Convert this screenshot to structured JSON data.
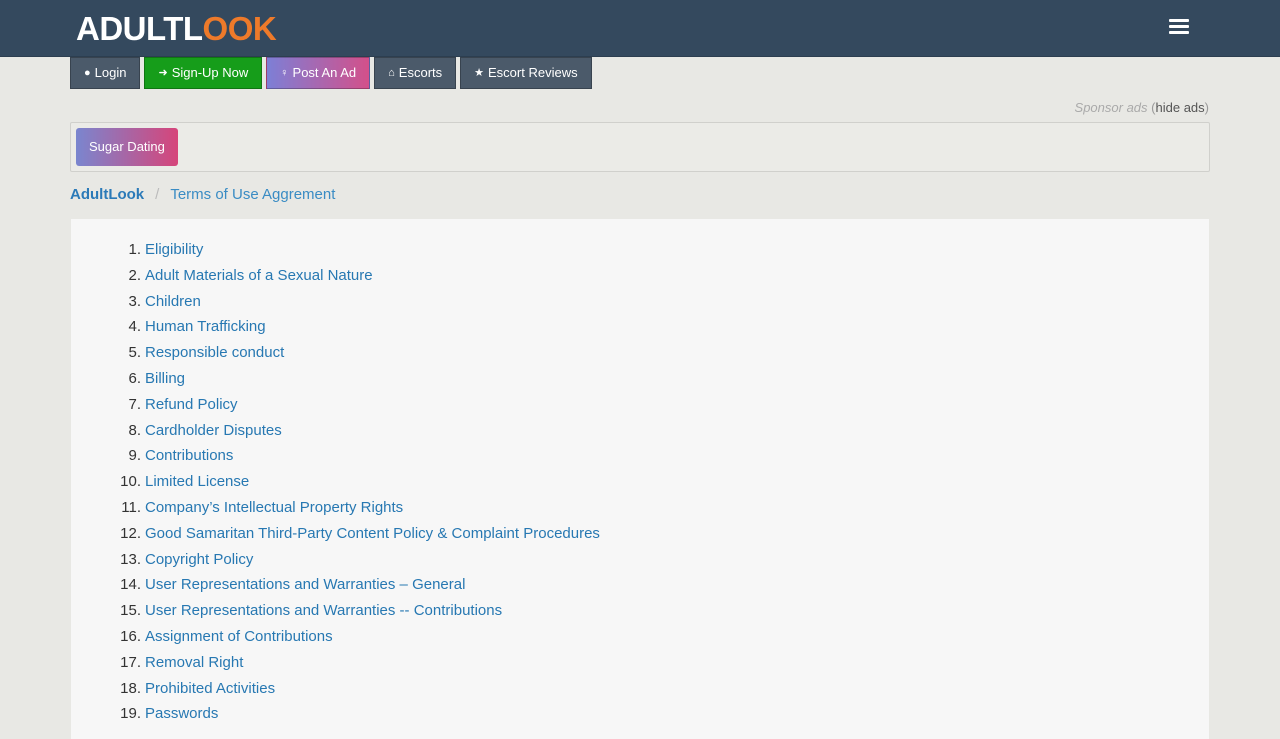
{
  "header": {
    "logo_part1": "ADULTL",
    "logo_part2": "OO",
    "logo_part3": "K"
  },
  "nav": {
    "login": "Login",
    "signup": "Sign-Up Now",
    "post_ad": "Post An Ad",
    "escorts": "Escorts",
    "reviews": "Escort Reviews"
  },
  "sponsor": {
    "label": "Sponsor ads",
    "open": "(",
    "hide": "hide ads",
    "close": ")"
  },
  "ad": {
    "sugar_dating": "Sugar Dating"
  },
  "breadcrumb": {
    "home": "AdultLook",
    "separator": "/",
    "current": "Terms of Use Aggrement"
  },
  "toc": [
    {
      "num": "1.",
      "label": "Eligibility"
    },
    {
      "num": "2.",
      "label": "Adult Materials of a Sexual Nature"
    },
    {
      "num": "3.",
      "label": "Children"
    },
    {
      "num": "4.",
      "label": "Human Trafficking"
    },
    {
      "num": "5.",
      "label": "Responsible conduct"
    },
    {
      "num": "6.",
      "label": "Billing"
    },
    {
      "num": "7.",
      "label": "Refund Policy"
    },
    {
      "num": "8.",
      "label": "Cardholder Disputes"
    },
    {
      "num": "9.",
      "label": "Contributions"
    },
    {
      "num": "10.",
      "label": "Limited License"
    },
    {
      "num": "11.",
      "label": "Company’s Intellectual Property Rights"
    },
    {
      "num": "12.",
      "label": "Good Samaritan Third-Party Content Policy & Complaint Procedures"
    },
    {
      "num": "13.",
      "label": "Copyright Policy"
    },
    {
      "num": "14.",
      "label": "User Representations and Warranties – General"
    },
    {
      "num": "15.",
      "label": "User Representations and Warranties -- Contributions"
    },
    {
      "num": "16.",
      "label": "Assignment of Contributions"
    },
    {
      "num": "17.",
      "label": "Removal Right"
    },
    {
      "num": "18.",
      "label": "Prohibited Activities"
    },
    {
      "num": "19.",
      "label": "Passwords"
    }
  ],
  "colors": {
    "header_bg": "#34495e",
    "link": "#2778b2",
    "signup_green": "#169d1a",
    "logo_orange": "#ee7a2a"
  },
  "icons": {
    "login": "user-icon",
    "signup": "sign-in-icon",
    "post_ad": "female-icon",
    "escorts": "home-icon",
    "reviews": "star-icon",
    "menu": "hamburger-icon"
  }
}
